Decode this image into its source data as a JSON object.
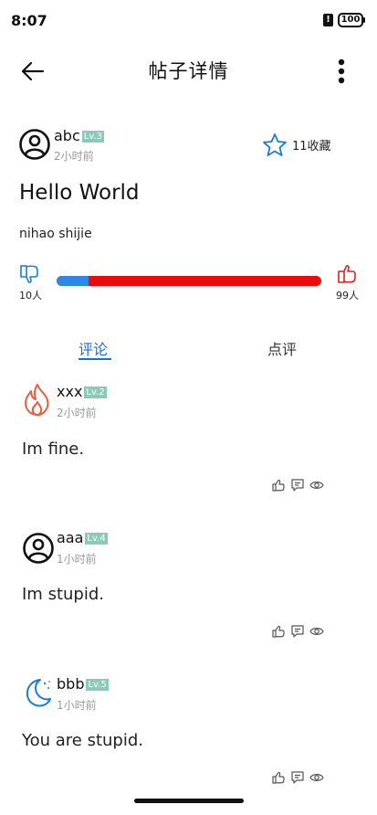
{
  "status": {
    "time": "8:07",
    "battery": "100"
  },
  "appbar": {
    "title": "帖子详情"
  },
  "post": {
    "author": "abc",
    "level": "Lv.3",
    "time": "2小时前",
    "favorites": "11收藏",
    "title": "Hello World",
    "body": "nihao shijie",
    "dislikes": "10人",
    "likes": "99人",
    "like_ratio": 0.12
  },
  "tabs": {
    "comments": "评论",
    "reviews": "点评"
  },
  "comments": [
    {
      "user": "xxx",
      "level": "Lv.2",
      "time": "2小时前",
      "text": "Im fine.",
      "avatar": "fire-icon"
    },
    {
      "user": "aaa",
      "level": "Lv.4",
      "time": "1小时前",
      "text": "Im stupid.",
      "avatar": "user-circle-icon"
    },
    {
      "user": "bbb",
      "level": "Lv.5",
      "time": "1小时前",
      "text": "You are stupid.",
      "avatar": "moon-icon"
    }
  ],
  "colors": {
    "accent": "#1a6fd8",
    "bar_blue": "#2f88e8",
    "bar_red": "#ee0a0a",
    "dislike": "#1a7fc9",
    "like": "#e02020",
    "level_bg": "#8cc9b8"
  }
}
